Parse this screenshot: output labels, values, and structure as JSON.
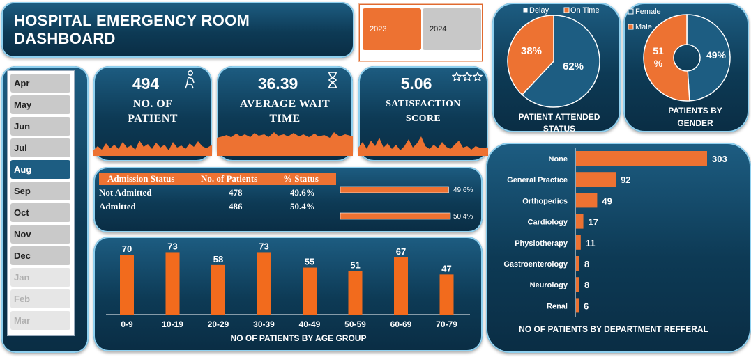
{
  "title": "HOSPITAL EMERGENCY ROOM DASHBOARD",
  "years": [
    "2023",
    "2024"
  ],
  "selected_year": "2023",
  "months": [
    {
      "label": "Apr",
      "state": "on"
    },
    {
      "label": "May",
      "state": "on"
    },
    {
      "label": "Jun",
      "state": "on"
    },
    {
      "label": "Jul",
      "state": "on"
    },
    {
      "label": "Aug",
      "state": "selected"
    },
    {
      "label": "Sep",
      "state": "on"
    },
    {
      "label": "Oct",
      "state": "on"
    },
    {
      "label": "Nov",
      "state": "on"
    },
    {
      "label": "Dec",
      "state": "on"
    },
    {
      "label": "Jan",
      "state": "off"
    },
    {
      "label": "Feb",
      "state": "off"
    },
    {
      "label": "Mar",
      "state": "off"
    }
  ],
  "kpis": {
    "patients": {
      "value": "494",
      "label1": "NO. OF",
      "label2": "PATIENT"
    },
    "wait": {
      "value": "36.39",
      "label1": "AVERAGE WAIT",
      "label2": "TIME"
    },
    "satisfaction": {
      "value": "5.06",
      "label1": "SATISFACTION",
      "label2": "SCORE"
    }
  },
  "admission": {
    "headers": [
      "Admission Status",
      "No. of Patients",
      "% Status"
    ],
    "rows": [
      {
        "status": "Not Admitted",
        "count": "478",
        "pct": "49.6%",
        "fraction": 0.496
      },
      {
        "status": "Admitted",
        "count": "486",
        "pct": "50.4%",
        "fraction": 0.504
      }
    ]
  },
  "colors": {
    "accent": "#ed7232",
    "navy": "#1d5d82",
    "dark": "#0d3a55"
  },
  "chart_data": [
    {
      "type": "bar",
      "title": "NO  OF PATIENTS BY AGE GROUP",
      "categories": [
        "0-9",
        "10-19",
        "20-29",
        "30-39",
        "40-49",
        "50-59",
        "60-69",
        "70-79"
      ],
      "values": [
        70,
        73,
        58,
        73,
        55,
        51,
        67,
        47
      ],
      "ylim": [
        0,
        75
      ]
    },
    {
      "type": "bar",
      "orientation": "horizontal",
      "title": "NO  OF PATIENTS BY DEPARTMENT REFFERAL",
      "categories": [
        "None",
        "General Practice",
        "Orthopedics",
        "Cardiology",
        "Physiotherapy",
        "Gastroenterology",
        "Neurology",
        "Renal"
      ],
      "values": [
        303,
        92,
        49,
        17,
        11,
        8,
        8,
        6
      ]
    },
    {
      "type": "pie",
      "title": "PATIENT ATTENDED STATUS",
      "legend": [
        "Delay",
        "On Time"
      ],
      "labels": [
        "On Time",
        "Delay"
      ],
      "values": [
        62,
        38
      ],
      "display": [
        "62%",
        "38%"
      ]
    },
    {
      "type": "pie",
      "subtype": "donut",
      "title": "PATIENTS BY GENDER",
      "legend": [
        "Female",
        "Male"
      ],
      "labels": [
        "Female",
        "Male"
      ],
      "values": [
        49,
        51
      ],
      "display": [
        "49%",
        "51 %"
      ]
    }
  ]
}
